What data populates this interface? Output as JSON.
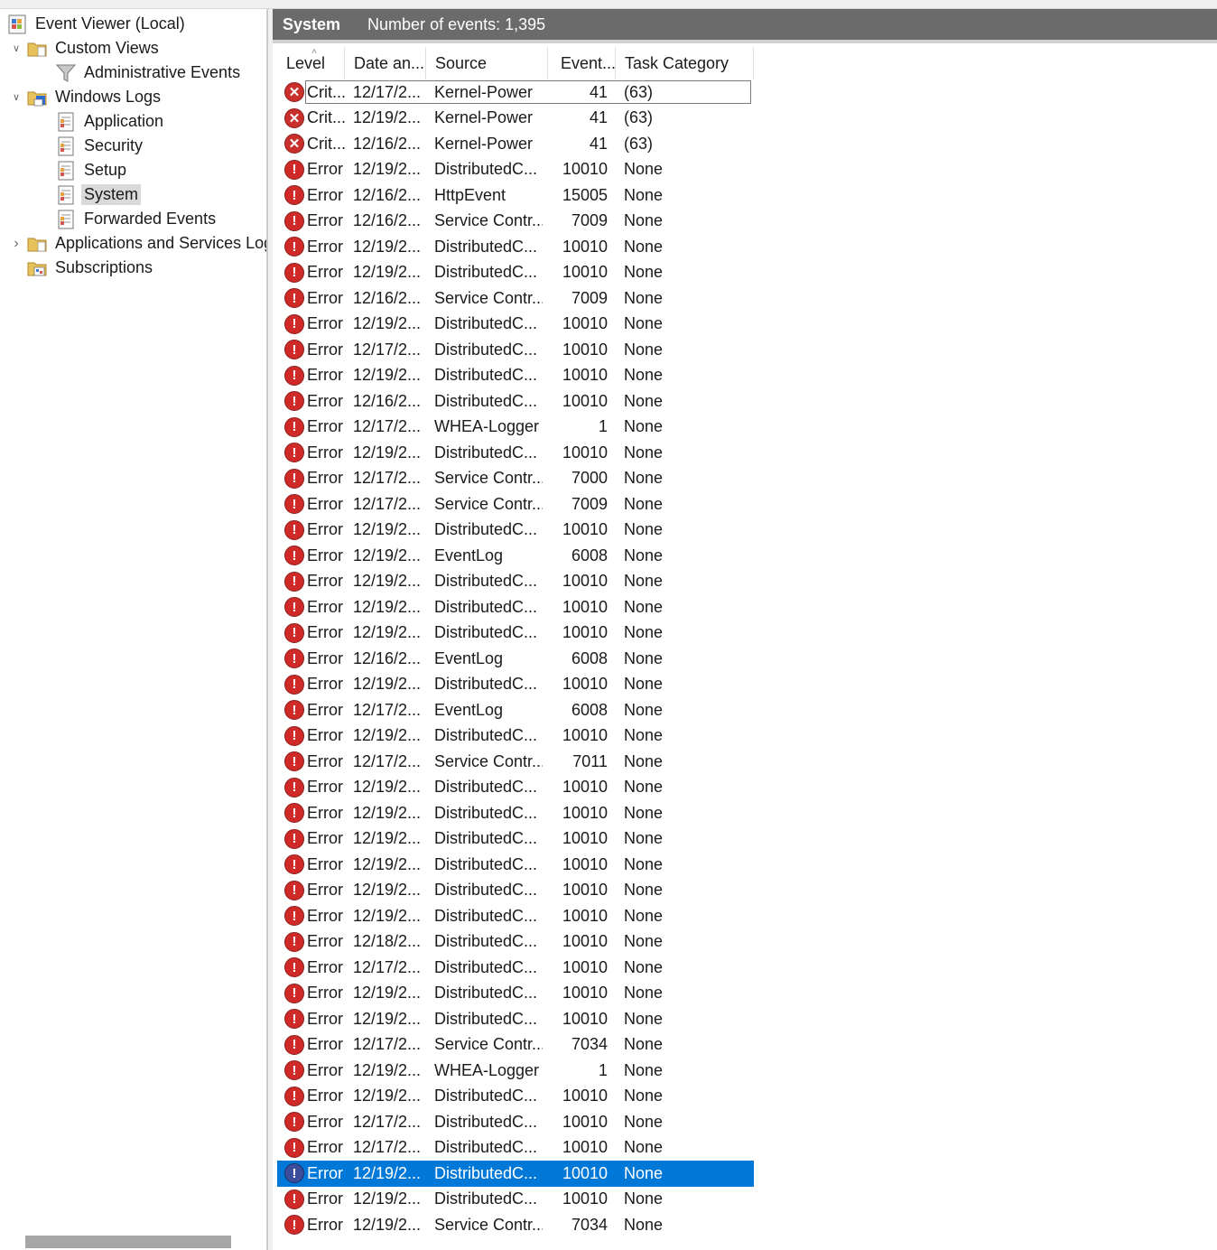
{
  "tree": {
    "nodes": [
      {
        "label": "Event Viewer (Local)",
        "icon": "event-viewer-icon",
        "level": 0,
        "expander": ""
      },
      {
        "label": "Custom Views",
        "icon": "folder-icon",
        "level": 1,
        "expander": "expanded"
      },
      {
        "label": "Administrative Events",
        "icon": "filter-icon",
        "level": 2,
        "expander": ""
      },
      {
        "label": "Windows Logs",
        "icon": "windows-logs-folder-icon",
        "level": 1,
        "expander": "expanded"
      },
      {
        "label": "Application",
        "icon": "log-icon",
        "level": 2,
        "expander": ""
      },
      {
        "label": "Security",
        "icon": "log-icon",
        "level": 2,
        "expander": ""
      },
      {
        "label": "Setup",
        "icon": "log-icon",
        "level": 2,
        "expander": ""
      },
      {
        "label": "System",
        "icon": "log-icon",
        "level": 2,
        "expander": "",
        "selected": true
      },
      {
        "label": "Forwarded Events",
        "icon": "log-icon",
        "level": 2,
        "expander": ""
      },
      {
        "label": "Applications and Services Logs",
        "icon": "folder-icon",
        "level": 1,
        "expander": "collapsed"
      },
      {
        "label": "Subscriptions",
        "icon": "subscriptions-icon",
        "level": 1,
        "expander": ""
      }
    ]
  },
  "header": {
    "log_name": "System",
    "event_count": "Number of events: 1,395"
  },
  "columns": {
    "level": "Level",
    "date": "Date an...",
    "source": "Source",
    "event_id": "Event...",
    "task": "Task Category"
  },
  "colors": {
    "selection": "#0078d7",
    "title_bar": "#6b6b6b",
    "error_icon": "#cf2a27"
  },
  "events": [
    {
      "level": "Crit...",
      "date": "12/17/2...",
      "source": "Kernel-Power",
      "id": "41",
      "task": "(63)",
      "icon": "critical-icon"
    },
    {
      "level": "Crit...",
      "date": "12/19/2...",
      "source": "Kernel-Power",
      "id": "41",
      "task": "(63)",
      "icon": "critical-icon"
    },
    {
      "level": "Crit...",
      "date": "12/16/2...",
      "source": "Kernel-Power",
      "id": "41",
      "task": "(63)",
      "icon": "critical-icon"
    },
    {
      "level": "Error",
      "date": "12/19/2...",
      "source": "DistributedC...",
      "id": "10010",
      "task": "None",
      "icon": "error-icon"
    },
    {
      "level": "Error",
      "date": "12/16/2...",
      "source": "HttpEvent",
      "id": "15005",
      "task": "None",
      "icon": "error-icon"
    },
    {
      "level": "Error",
      "date": "12/16/2...",
      "source": "Service Contr...",
      "id": "7009",
      "task": "None",
      "icon": "error-icon"
    },
    {
      "level": "Error",
      "date": "12/19/2...",
      "source": "DistributedC...",
      "id": "10010",
      "task": "None",
      "icon": "error-icon"
    },
    {
      "level": "Error",
      "date": "12/19/2...",
      "source": "DistributedC...",
      "id": "10010",
      "task": "None",
      "icon": "error-icon"
    },
    {
      "level": "Error",
      "date": "12/16/2...",
      "source": "Service Contr...",
      "id": "7009",
      "task": "None",
      "icon": "error-icon"
    },
    {
      "level": "Error",
      "date": "12/19/2...",
      "source": "DistributedC...",
      "id": "10010",
      "task": "None",
      "icon": "error-icon"
    },
    {
      "level": "Error",
      "date": "12/17/2...",
      "source": "DistributedC...",
      "id": "10010",
      "task": "None",
      "icon": "error-icon"
    },
    {
      "level": "Error",
      "date": "12/19/2...",
      "source": "DistributedC...",
      "id": "10010",
      "task": "None",
      "icon": "error-icon"
    },
    {
      "level": "Error",
      "date": "12/16/2...",
      "source": "DistributedC...",
      "id": "10010",
      "task": "None",
      "icon": "error-icon"
    },
    {
      "level": "Error",
      "date": "12/17/2...",
      "source": "WHEA-Logger",
      "id": "1",
      "task": "None",
      "icon": "error-icon"
    },
    {
      "level": "Error",
      "date": "12/19/2...",
      "source": "DistributedC...",
      "id": "10010",
      "task": "None",
      "icon": "error-icon"
    },
    {
      "level": "Error",
      "date": "12/17/2...",
      "source": "Service Contr...",
      "id": "7000",
      "task": "None",
      "icon": "error-icon"
    },
    {
      "level": "Error",
      "date": "12/17/2...",
      "source": "Service Contr...",
      "id": "7009",
      "task": "None",
      "icon": "error-icon"
    },
    {
      "level": "Error",
      "date": "12/19/2...",
      "source": "DistributedC...",
      "id": "10010",
      "task": "None",
      "icon": "error-icon"
    },
    {
      "level": "Error",
      "date": "12/19/2...",
      "source": "EventLog",
      "id": "6008",
      "task": "None",
      "icon": "error-icon"
    },
    {
      "level": "Error",
      "date": "12/19/2...",
      "source": "DistributedC...",
      "id": "10010",
      "task": "None",
      "icon": "error-icon"
    },
    {
      "level": "Error",
      "date": "12/19/2...",
      "source": "DistributedC...",
      "id": "10010",
      "task": "None",
      "icon": "error-icon"
    },
    {
      "level": "Error",
      "date": "12/19/2...",
      "source": "DistributedC...",
      "id": "10010",
      "task": "None",
      "icon": "error-icon"
    },
    {
      "level": "Error",
      "date": "12/16/2...",
      "source": "EventLog",
      "id": "6008",
      "task": "None",
      "icon": "error-icon"
    },
    {
      "level": "Error",
      "date": "12/19/2...",
      "source": "DistributedC...",
      "id": "10010",
      "task": "None",
      "icon": "error-icon"
    },
    {
      "level": "Error",
      "date": "12/17/2...",
      "source": "EventLog",
      "id": "6008",
      "task": "None",
      "icon": "error-icon"
    },
    {
      "level": "Error",
      "date": "12/19/2...",
      "source": "DistributedC...",
      "id": "10010",
      "task": "None",
      "icon": "error-icon"
    },
    {
      "level": "Error",
      "date": "12/17/2...",
      "source": "Service Contr...",
      "id": "7011",
      "task": "None",
      "icon": "error-icon"
    },
    {
      "level": "Error",
      "date": "12/19/2...",
      "source": "DistributedC...",
      "id": "10010",
      "task": "None",
      "icon": "error-icon"
    },
    {
      "level": "Error",
      "date": "12/19/2...",
      "source": "DistributedC...",
      "id": "10010",
      "task": "None",
      "icon": "error-icon"
    },
    {
      "level": "Error",
      "date": "12/19/2...",
      "source": "DistributedC...",
      "id": "10010",
      "task": "None",
      "icon": "error-icon"
    },
    {
      "level": "Error",
      "date": "12/19/2...",
      "source": "DistributedC...",
      "id": "10010",
      "task": "None",
      "icon": "error-icon"
    },
    {
      "level": "Error",
      "date": "12/19/2...",
      "source": "DistributedC...",
      "id": "10010",
      "task": "None",
      "icon": "error-icon"
    },
    {
      "level": "Error",
      "date": "12/19/2...",
      "source": "DistributedC...",
      "id": "10010",
      "task": "None",
      "icon": "error-icon"
    },
    {
      "level": "Error",
      "date": "12/18/2...",
      "source": "DistributedC...",
      "id": "10010",
      "task": "None",
      "icon": "error-icon"
    },
    {
      "level": "Error",
      "date": "12/17/2...",
      "source": "DistributedC...",
      "id": "10010",
      "task": "None",
      "icon": "error-icon"
    },
    {
      "level": "Error",
      "date": "12/19/2...",
      "source": "DistributedC...",
      "id": "10010",
      "task": "None",
      "icon": "error-icon"
    },
    {
      "level": "Error",
      "date": "12/19/2...",
      "source": "DistributedC...",
      "id": "10010",
      "task": "None",
      "icon": "error-icon"
    },
    {
      "level": "Error",
      "date": "12/17/2...",
      "source": "Service Contr...",
      "id": "7034",
      "task": "None",
      "icon": "error-icon"
    },
    {
      "level": "Error",
      "date": "12/19/2...",
      "source": "WHEA-Logger",
      "id": "1",
      "task": "None",
      "icon": "error-icon"
    },
    {
      "level": "Error",
      "date": "12/19/2...",
      "source": "DistributedC...",
      "id": "10010",
      "task": "None",
      "icon": "error-icon"
    },
    {
      "level": "Error",
      "date": "12/17/2...",
      "source": "DistributedC...",
      "id": "10010",
      "task": "None",
      "icon": "error-icon"
    },
    {
      "level": "Error",
      "date": "12/17/2...",
      "source": "DistributedC...",
      "id": "10010",
      "task": "None",
      "icon": "error-icon"
    },
    {
      "level": "Error",
      "date": "12/19/2...",
      "source": "DistributedC...",
      "id": "10010",
      "task": "None",
      "icon": "error-icon",
      "selected": true
    },
    {
      "level": "Error",
      "date": "12/19/2...",
      "source": "DistributedC...",
      "id": "10010",
      "task": "None",
      "icon": "error-icon"
    },
    {
      "level": "Error",
      "date": "12/19/2...",
      "source": "Service Contr...",
      "id": "7034",
      "task": "None",
      "icon": "error-icon"
    }
  ]
}
